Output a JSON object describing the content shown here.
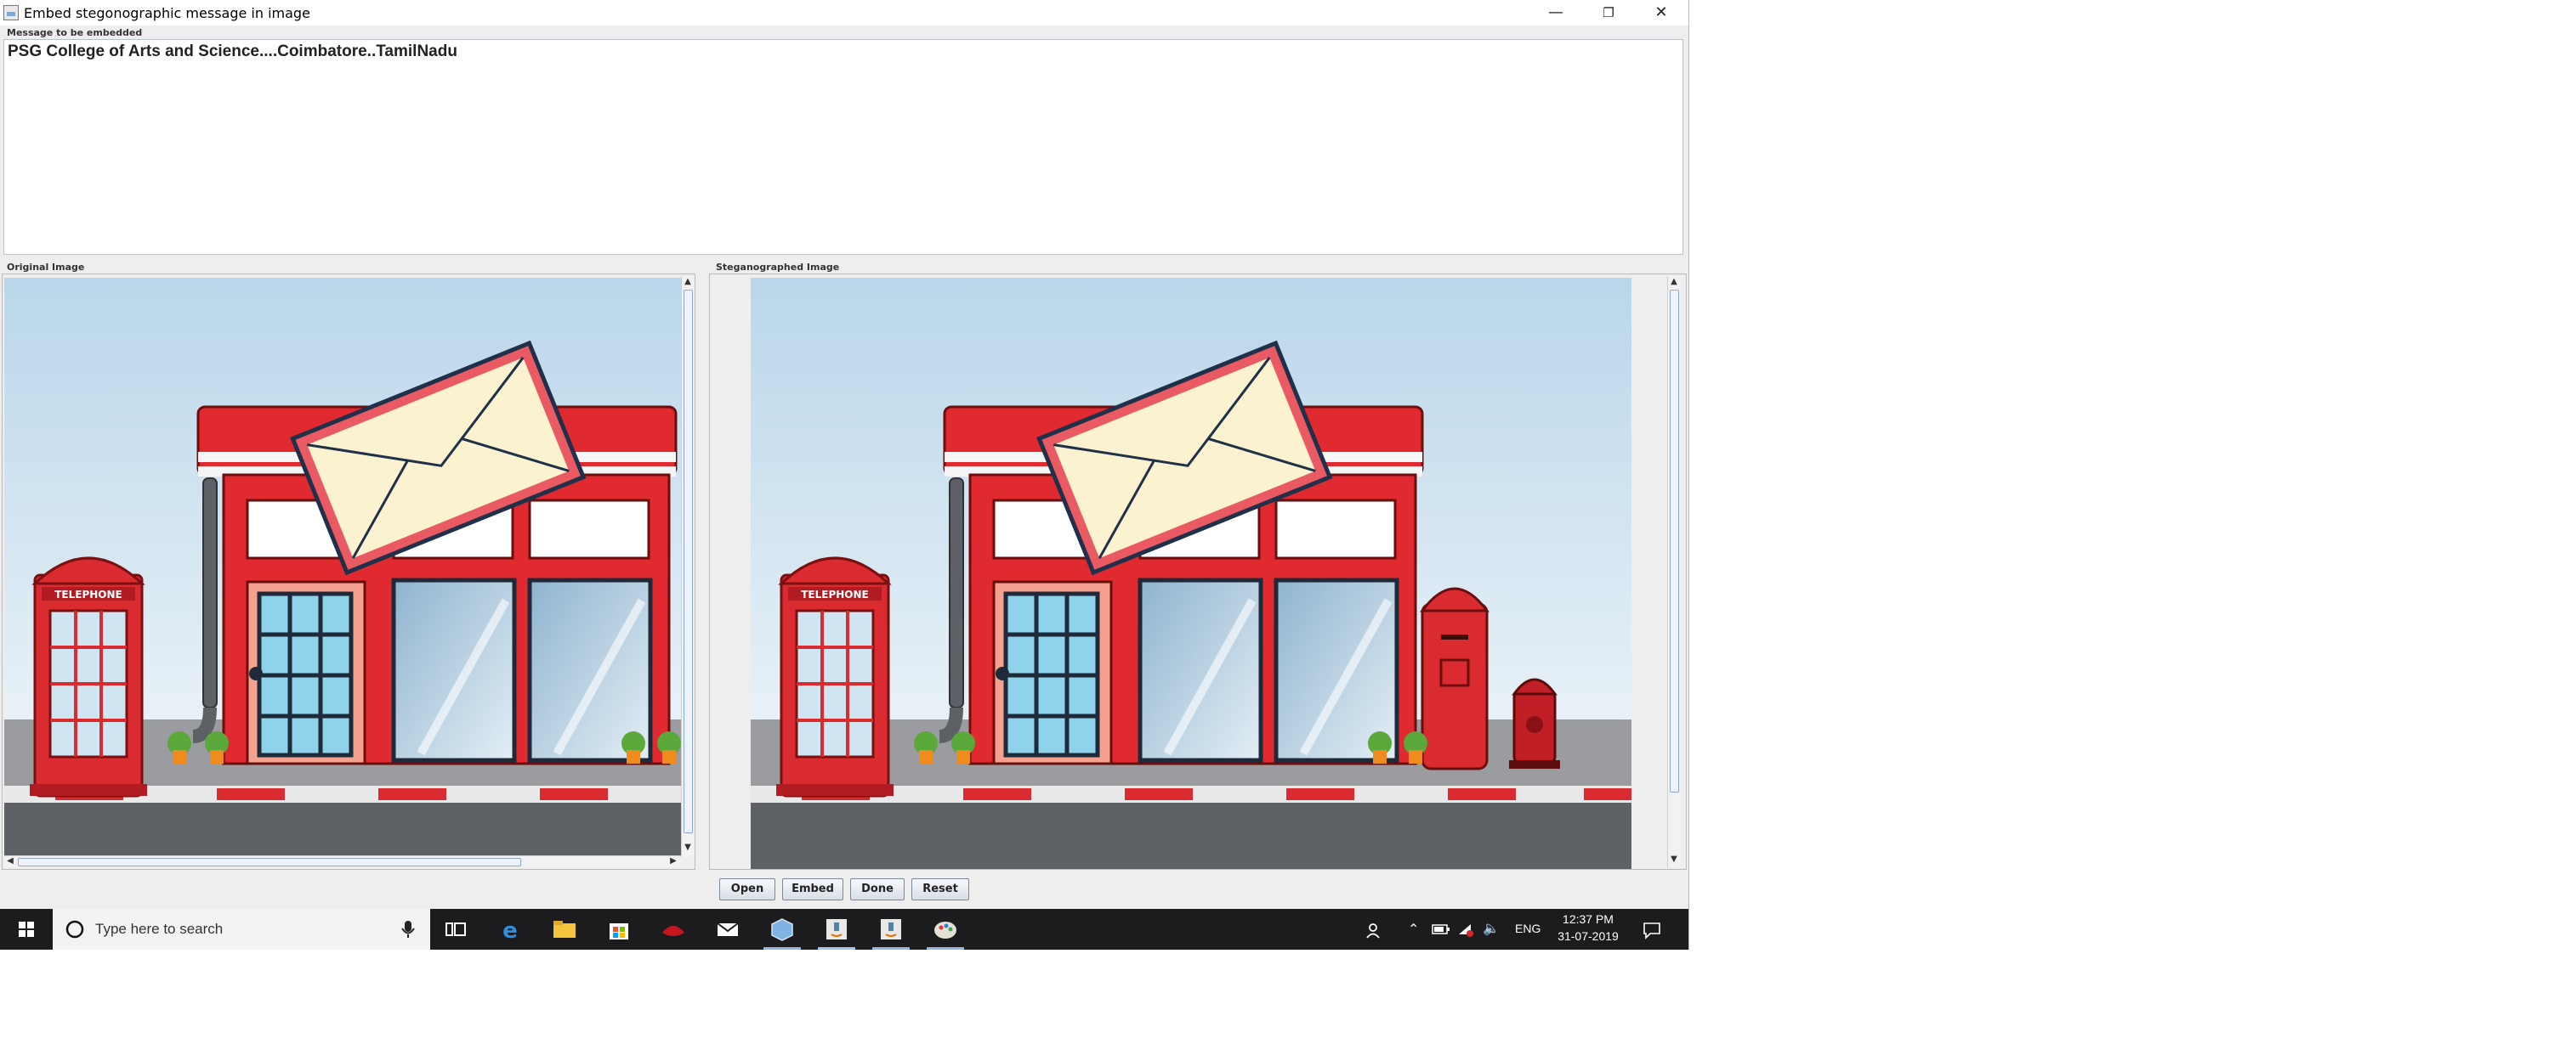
{
  "window": {
    "title": "Embed stegonographic message in image",
    "controls": {
      "minimize": "—",
      "restore": "❐",
      "close": "✕"
    }
  },
  "message": {
    "label": "Message to be embedded",
    "text": "PSG College of Arts and Science....Coimbatore..TamilNadu"
  },
  "panels": {
    "original": {
      "label": "Original Image"
    },
    "steganographed": {
      "label": "Steganographed Image"
    }
  },
  "image_signs": {
    "telephone": "TELEPHONE"
  },
  "buttons": {
    "open": "Open",
    "embed": "Embed",
    "done": "Done",
    "reset": "Reset"
  },
  "taskbar": {
    "search_placeholder": "Type here to search",
    "icons": [
      "task-view-icon",
      "edge-icon",
      "file-explorer-icon",
      "store-icon",
      "mcafee-icon",
      "mail-icon",
      "app-cube-icon",
      "java-app-icon",
      "java-app-icon",
      "paint-icon"
    ],
    "language": "ENG",
    "time": "12:37 PM",
    "date": "31-07-2019"
  },
  "colors": {
    "accent": "#0078d7",
    "taskbar": "#1c1c1f",
    "red": "#e02a2f"
  }
}
